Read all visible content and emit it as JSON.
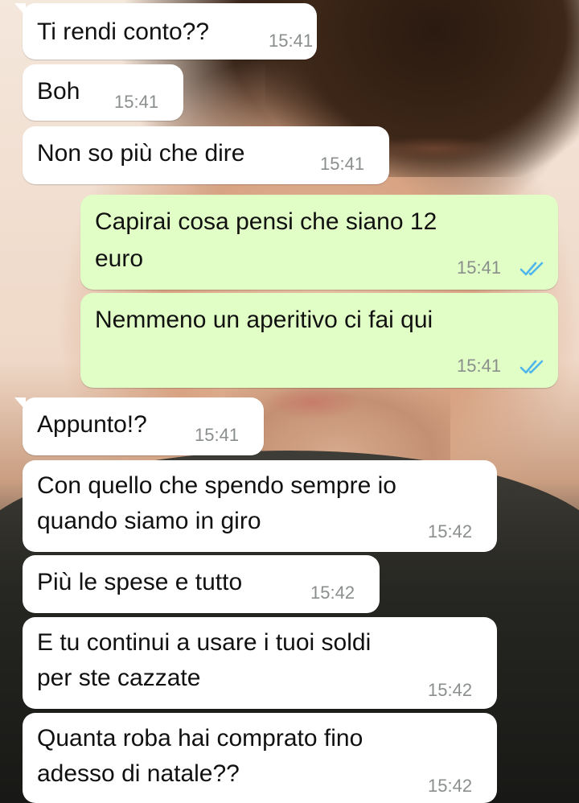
{
  "chat": {
    "messages": [
      {
        "direction": "in",
        "lines": [
          "Ti rendi conto??"
        ],
        "time": "15:41"
      },
      {
        "direction": "in",
        "lines": [
          "Boh"
        ],
        "time": "15:41"
      },
      {
        "direction": "in",
        "lines": [
          "Non so più che dire"
        ],
        "time": "15:41"
      },
      {
        "direction": "out",
        "lines": [
          "Capirai cosa pensi che siano 12",
          "euro"
        ],
        "time": "15:41",
        "status_icon": "double-check-read-icon"
      },
      {
        "direction": "out",
        "lines": [
          "Nemmeno un aperitivo ci fai qui"
        ],
        "time": "15:41",
        "status_icon": "double-check-read-icon"
      },
      {
        "direction": "in",
        "lines": [
          "Appunto!?"
        ],
        "time": "15:41"
      },
      {
        "direction": "in",
        "lines": [
          "Con quello che spendo sempre io",
          "quando siamo in giro"
        ],
        "time": "15:42"
      },
      {
        "direction": "in",
        "lines": [
          "Più le spese e tutto"
        ],
        "time": "15:42"
      },
      {
        "direction": "in",
        "lines": [
          "E tu continui a usare i tuoi soldi",
          "per ste cazzate"
        ],
        "time": "15:42"
      },
      {
        "direction": "in",
        "lines": [
          "Quanta roba hai comprato fino",
          "adesso di natale??"
        ],
        "time": "15:42"
      }
    ]
  },
  "colors": {
    "incoming_bubble": "#ffffff",
    "outgoing_bubble": "#e1fec6",
    "read_ticks": "#4fb6ec",
    "timestamp": "#8a8f8c"
  }
}
